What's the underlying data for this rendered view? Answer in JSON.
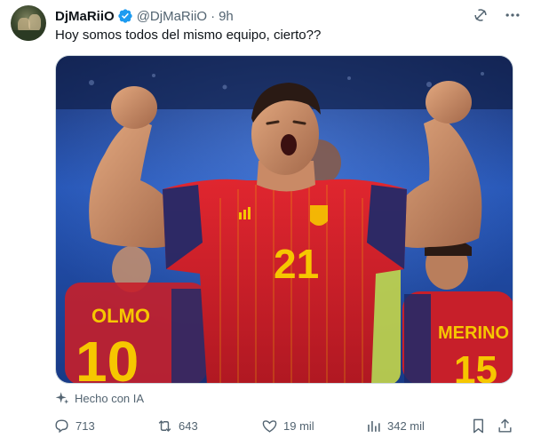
{
  "author": {
    "display_name": "DjMaRiiO",
    "handle": "@DjMaRiiO",
    "separator": "·",
    "time": "9h",
    "verified_color": "#1d9bf0"
  },
  "tweet": {
    "text": "Hoy somos todos del mismo equipo, cierto??"
  },
  "media": {
    "jersey_number_main": "21",
    "player_left_name": "OLMO",
    "player_left_number": "10",
    "player_right_name": "MERINO",
    "player_right_number": "15"
  },
  "ai_label": "Hecho con IA",
  "actions": {
    "replies": "713",
    "retweets": "643",
    "likes": "19 mil",
    "views": "342 mil"
  },
  "colors": {
    "text_primary": "#0f1419",
    "text_secondary": "#536471",
    "accent": "#1d9bf0",
    "jersey_red": "#d3212c",
    "jersey_yellow": "#f6c700",
    "stadium_blue": "#1c3f8f"
  },
  "icons": [
    "grok-icon",
    "more-icon",
    "sparkle-icon",
    "reply-icon",
    "retweet-icon",
    "like-icon",
    "views-icon",
    "bookmark-icon",
    "share-icon"
  ]
}
